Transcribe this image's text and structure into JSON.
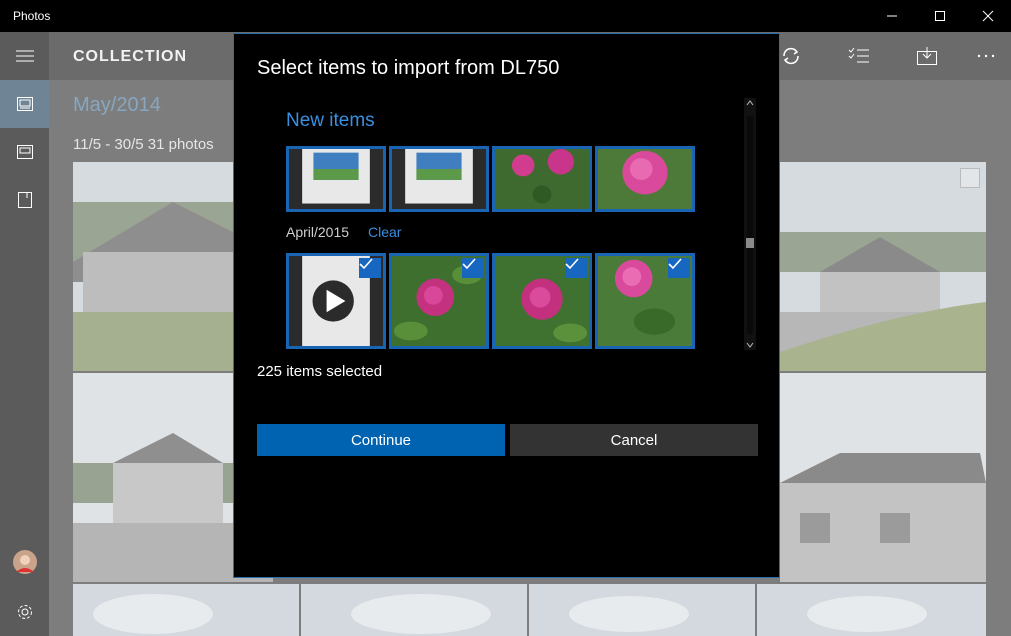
{
  "window": {
    "title": "Photos"
  },
  "header": {
    "title": "COLLECTION"
  },
  "collection": {
    "month": "May/2014",
    "range": "11/5 - 30/5   31 photos"
  },
  "dialog": {
    "title": "Select items to import from DL750",
    "section_title": "New items",
    "group_label": "April/2015",
    "clear_label": "Clear",
    "selected_count": "225 items selected",
    "continue_label": "Continue",
    "cancel_label": "Cancel"
  },
  "colors": {
    "accent": "#0063b1",
    "link": "#3a8fe0",
    "selection_border": "#1a64b4"
  },
  "icons": {
    "hamburger": "hamburger-menu-icon",
    "refresh": "refresh-icon",
    "select": "select-list-icon",
    "import": "import-icon",
    "more": "more-icon",
    "settings": "gear-icon"
  }
}
